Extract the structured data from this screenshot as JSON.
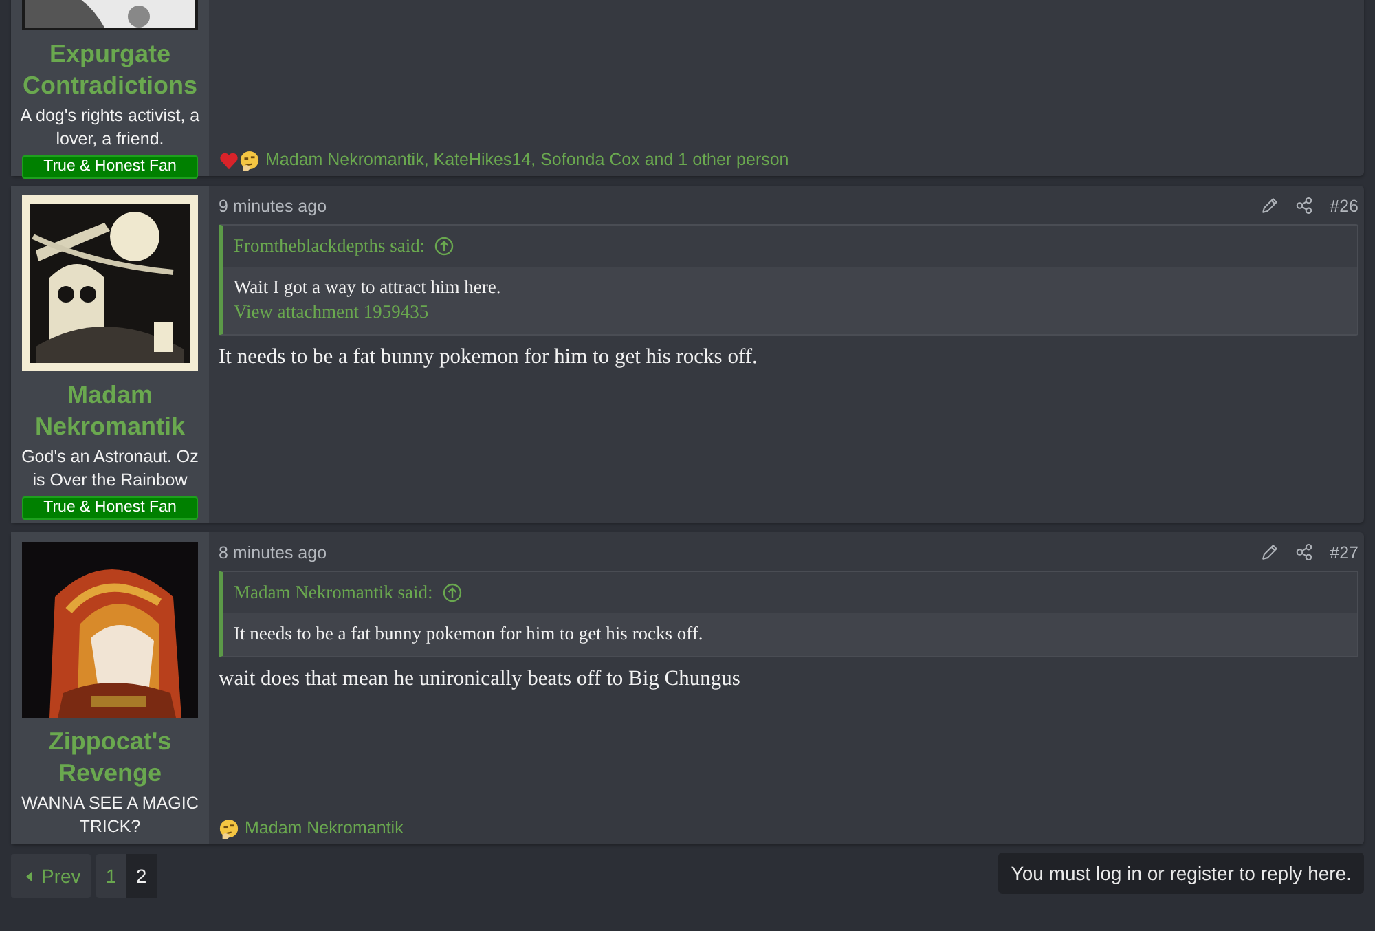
{
  "posts": [
    {
      "author": "Expurgate Contradictions",
      "user_title": "A dog's rights activist, a lover, a friend.",
      "banner": "True & Honest Fan",
      "reactions": {
        "icons": [
          {
            "kind": "heart"
          },
          {
            "kind": "thinking"
          }
        ],
        "text": "Madam Nekromantik, KateHikes14, Sofonda Cox and 1 other person"
      }
    },
    {
      "author": "Madam Nekromantik",
      "user_title": "God's an Astronaut. Oz is Over the Rainbow",
      "banner": "True & Honest Fan",
      "time": "9 minutes ago",
      "number": "#26",
      "quote": {
        "author": "Fromtheblackdepths said:",
        "text": "Wait I got a way to attract him here.",
        "link": "View attachment 1959435"
      },
      "body": "It needs to be a fat bunny pokemon for him to get his rocks off."
    },
    {
      "author": "Zippocat's Revenge",
      "user_title": "WANNA SEE A MAGIC TRICK?",
      "time": "8 minutes ago",
      "number": "#27",
      "quote": {
        "author": "Madam Nekromantik said:",
        "text": "It needs to be a fat bunny pokemon for him to get his rocks off."
      },
      "body": "wait does that mean he unironically beats off to Big Chungus",
      "reactions": {
        "icons": [
          {
            "kind": "thinking"
          }
        ],
        "text": "Madam Nekromantik"
      }
    }
  ],
  "pagination": {
    "prev": "Prev",
    "pages": [
      {
        "label": "1",
        "selected": false
      },
      {
        "label": "2",
        "selected": true
      }
    ]
  },
  "reply_notice": "You must log in or register to reply here."
}
